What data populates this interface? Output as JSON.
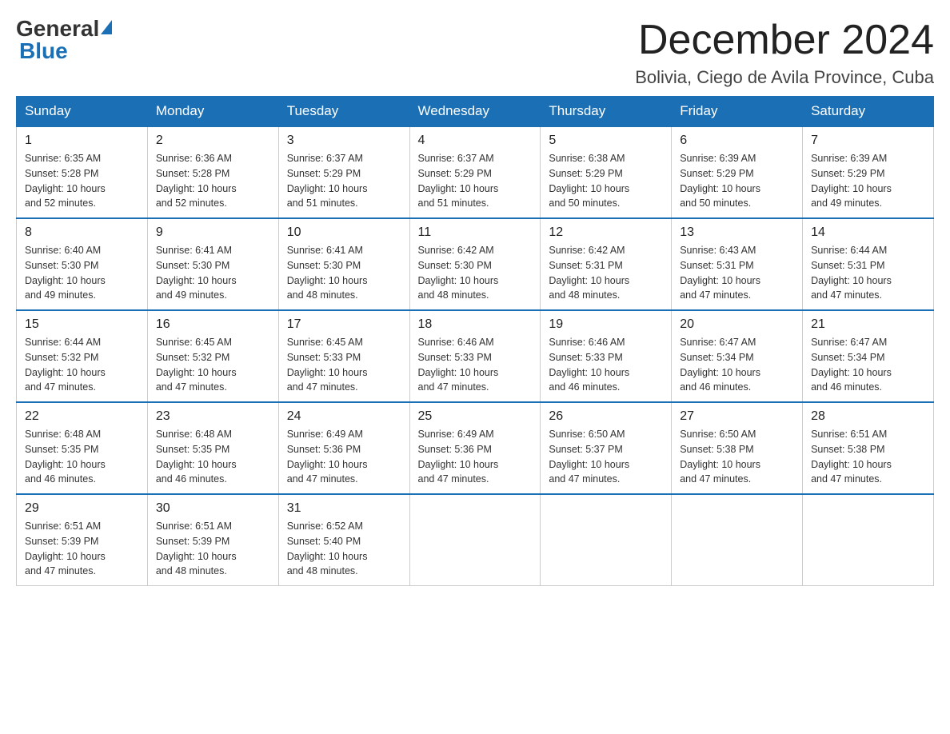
{
  "logo": {
    "general": "General",
    "blue": "Blue"
  },
  "title": "December 2024",
  "subtitle": "Bolivia, Ciego de Avila Province, Cuba",
  "days_of_week": [
    "Sunday",
    "Monday",
    "Tuesday",
    "Wednesday",
    "Thursday",
    "Friday",
    "Saturday"
  ],
  "weeks": [
    [
      {
        "day": "1",
        "sunrise": "6:35 AM",
        "sunset": "5:28 PM",
        "daylight": "10 hours and 52 minutes."
      },
      {
        "day": "2",
        "sunrise": "6:36 AM",
        "sunset": "5:28 PM",
        "daylight": "10 hours and 52 minutes."
      },
      {
        "day": "3",
        "sunrise": "6:37 AM",
        "sunset": "5:29 PM",
        "daylight": "10 hours and 51 minutes."
      },
      {
        "day": "4",
        "sunrise": "6:37 AM",
        "sunset": "5:29 PM",
        "daylight": "10 hours and 51 minutes."
      },
      {
        "day": "5",
        "sunrise": "6:38 AM",
        "sunset": "5:29 PM",
        "daylight": "10 hours and 50 minutes."
      },
      {
        "day": "6",
        "sunrise": "6:39 AM",
        "sunset": "5:29 PM",
        "daylight": "10 hours and 50 minutes."
      },
      {
        "day": "7",
        "sunrise": "6:39 AM",
        "sunset": "5:29 PM",
        "daylight": "10 hours and 49 minutes."
      }
    ],
    [
      {
        "day": "8",
        "sunrise": "6:40 AM",
        "sunset": "5:30 PM",
        "daylight": "10 hours and 49 minutes."
      },
      {
        "day": "9",
        "sunrise": "6:41 AM",
        "sunset": "5:30 PM",
        "daylight": "10 hours and 49 minutes."
      },
      {
        "day": "10",
        "sunrise": "6:41 AM",
        "sunset": "5:30 PM",
        "daylight": "10 hours and 48 minutes."
      },
      {
        "day": "11",
        "sunrise": "6:42 AM",
        "sunset": "5:30 PM",
        "daylight": "10 hours and 48 minutes."
      },
      {
        "day": "12",
        "sunrise": "6:42 AM",
        "sunset": "5:31 PM",
        "daylight": "10 hours and 48 minutes."
      },
      {
        "day": "13",
        "sunrise": "6:43 AM",
        "sunset": "5:31 PM",
        "daylight": "10 hours and 47 minutes."
      },
      {
        "day": "14",
        "sunrise": "6:44 AM",
        "sunset": "5:31 PM",
        "daylight": "10 hours and 47 minutes."
      }
    ],
    [
      {
        "day": "15",
        "sunrise": "6:44 AM",
        "sunset": "5:32 PM",
        "daylight": "10 hours and 47 minutes."
      },
      {
        "day": "16",
        "sunrise": "6:45 AM",
        "sunset": "5:32 PM",
        "daylight": "10 hours and 47 minutes."
      },
      {
        "day": "17",
        "sunrise": "6:45 AM",
        "sunset": "5:33 PM",
        "daylight": "10 hours and 47 minutes."
      },
      {
        "day": "18",
        "sunrise": "6:46 AM",
        "sunset": "5:33 PM",
        "daylight": "10 hours and 47 minutes."
      },
      {
        "day": "19",
        "sunrise": "6:46 AM",
        "sunset": "5:33 PM",
        "daylight": "10 hours and 46 minutes."
      },
      {
        "day": "20",
        "sunrise": "6:47 AM",
        "sunset": "5:34 PM",
        "daylight": "10 hours and 46 minutes."
      },
      {
        "day": "21",
        "sunrise": "6:47 AM",
        "sunset": "5:34 PM",
        "daylight": "10 hours and 46 minutes."
      }
    ],
    [
      {
        "day": "22",
        "sunrise": "6:48 AM",
        "sunset": "5:35 PM",
        "daylight": "10 hours and 46 minutes."
      },
      {
        "day": "23",
        "sunrise": "6:48 AM",
        "sunset": "5:35 PM",
        "daylight": "10 hours and 46 minutes."
      },
      {
        "day": "24",
        "sunrise": "6:49 AM",
        "sunset": "5:36 PM",
        "daylight": "10 hours and 47 minutes."
      },
      {
        "day": "25",
        "sunrise": "6:49 AM",
        "sunset": "5:36 PM",
        "daylight": "10 hours and 47 minutes."
      },
      {
        "day": "26",
        "sunrise": "6:50 AM",
        "sunset": "5:37 PM",
        "daylight": "10 hours and 47 minutes."
      },
      {
        "day": "27",
        "sunrise": "6:50 AM",
        "sunset": "5:38 PM",
        "daylight": "10 hours and 47 minutes."
      },
      {
        "day": "28",
        "sunrise": "6:51 AM",
        "sunset": "5:38 PM",
        "daylight": "10 hours and 47 minutes."
      }
    ],
    [
      {
        "day": "29",
        "sunrise": "6:51 AM",
        "sunset": "5:39 PM",
        "daylight": "10 hours and 47 minutes."
      },
      {
        "day": "30",
        "sunrise": "6:51 AM",
        "sunset": "5:39 PM",
        "daylight": "10 hours and 48 minutes."
      },
      {
        "day": "31",
        "sunrise": "6:52 AM",
        "sunset": "5:40 PM",
        "daylight": "10 hours and 48 minutes."
      },
      null,
      null,
      null,
      null
    ]
  ],
  "labels": {
    "sunrise": "Sunrise:",
    "sunset": "Sunset:",
    "daylight": "Daylight:"
  }
}
